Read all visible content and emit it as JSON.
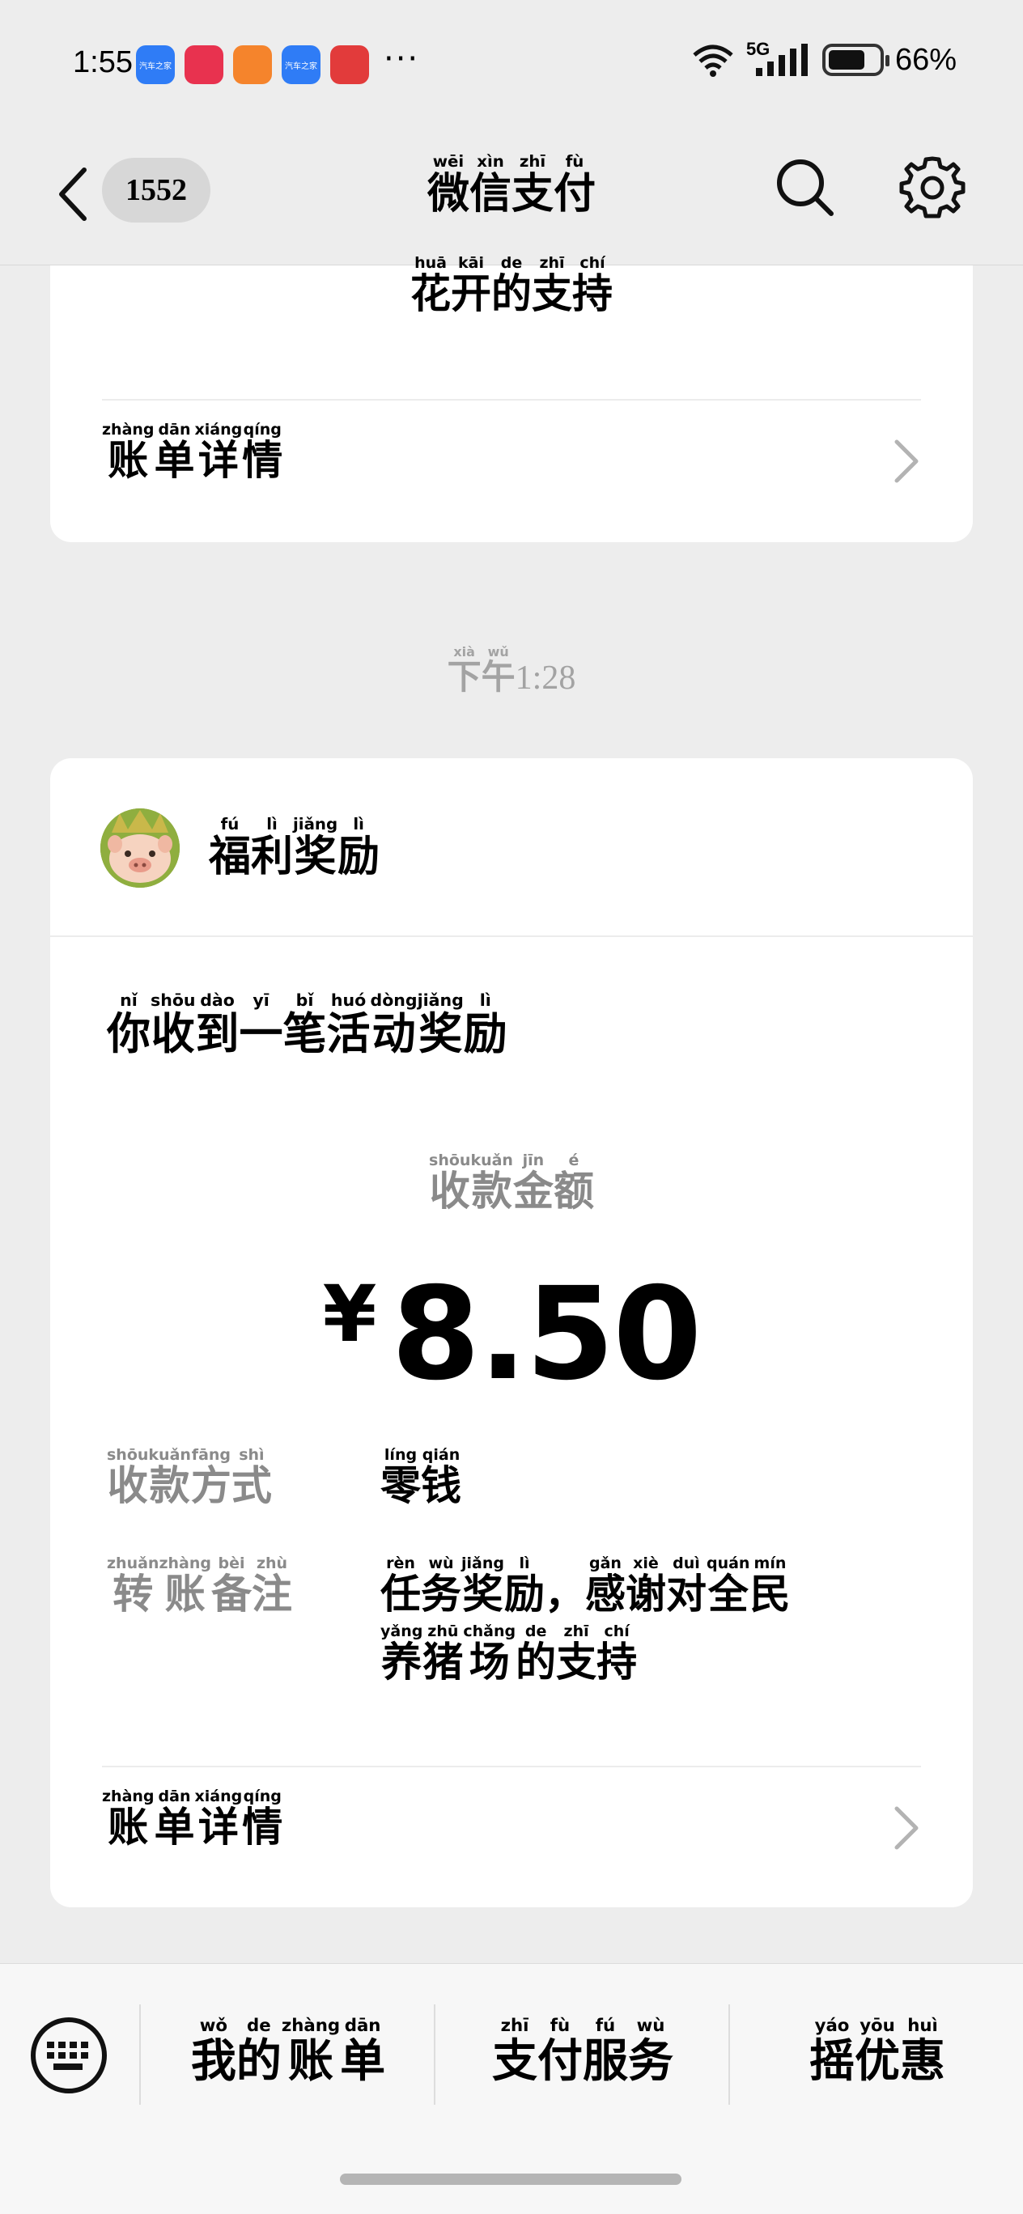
{
  "status_bar": {
    "time": "1:55",
    "app_icons": [
      {
        "name": "qiche-zhijia-icon",
        "label": "汽车之家",
        "color": "#2f7cf6"
      },
      {
        "name": "douyin-icon",
        "label": "",
        "color": "#e8324f"
      },
      {
        "name": "orange-app-icon",
        "label": "",
        "color": "#f5842c"
      },
      {
        "name": "qiche-zhijia-icon",
        "label": "汽车之家",
        "color": "#2f7cf6"
      },
      {
        "name": "red-app-icon",
        "label": "",
        "color": "#e23b3b"
      }
    ],
    "more": "···",
    "network": "5G",
    "battery": "66%"
  },
  "nav": {
    "unread_count": "1552",
    "title": [
      [
        "微",
        "wēi"
      ],
      [
        "信",
        "xìn"
      ],
      [
        "支",
        "zhī"
      ],
      [
        "付",
        "fù"
      ]
    ]
  },
  "prev_card": {
    "partial_text": [
      [
        "花",
        "huā"
      ],
      [
        "开",
        "kāi"
      ],
      [
        "的",
        "de"
      ],
      [
        "支",
        "zhī"
      ],
      [
        "持",
        "chí"
      ]
    ],
    "bill_details": [
      [
        "账",
        "zhàng"
      ],
      [
        "单",
        "dān"
      ],
      [
        "详",
        "xiáng"
      ],
      [
        "情",
        "qíng"
      ]
    ]
  },
  "time_separator": {
    "ruby": [
      [
        "下",
        "xià"
      ],
      [
        "午",
        "wǔ"
      ]
    ],
    "time": "1:28"
  },
  "main_card": {
    "sender": [
      [
        "福",
        "fú"
      ],
      [
        "利",
        "lì"
      ],
      [
        "奖",
        "jiǎng"
      ],
      [
        "励",
        "lì"
      ]
    ],
    "notice": [
      [
        "你",
        "nǐ"
      ],
      [
        "收",
        "shōu"
      ],
      [
        "到",
        "dào"
      ],
      [
        "一",
        "yī"
      ],
      [
        "笔",
        "bǐ"
      ],
      [
        "活",
        "huó"
      ],
      [
        "动",
        "dòng"
      ],
      [
        "奖",
        "jiǎng"
      ],
      [
        "励",
        "lì"
      ]
    ],
    "amount_label": [
      [
        "收",
        "shōu"
      ],
      [
        "款",
        "kuǎn"
      ],
      [
        "金",
        "jīn"
      ],
      [
        "额",
        "é"
      ]
    ],
    "currency": "¥",
    "amount": "8.50",
    "method_label": [
      [
        "收",
        "shōu"
      ],
      [
        "款",
        "kuǎn"
      ],
      [
        "方",
        "fāng"
      ],
      [
        "式",
        "shì"
      ]
    ],
    "method_value": [
      [
        "零",
        "líng"
      ],
      [
        "钱",
        "qián"
      ]
    ],
    "note_label": [
      [
        "转",
        "zhuǎn"
      ],
      [
        "账",
        "zhàng"
      ],
      [
        "备",
        "bèi"
      ],
      [
        "注",
        "zhù"
      ]
    ],
    "note_line1": [
      [
        "任",
        "rèn"
      ],
      [
        "务",
        "wù"
      ],
      [
        "奖",
        "jiǎng"
      ],
      [
        "励",
        "lì"
      ],
      [
        "，",
        ""
      ],
      [
        "感",
        "gǎn"
      ],
      [
        "谢",
        "xiè"
      ],
      [
        "对",
        "duì"
      ],
      [
        "全",
        "quán"
      ],
      [
        "民",
        "mín"
      ]
    ],
    "note_line2": [
      [
        "养",
        "yǎng"
      ],
      [
        "猪",
        "zhū"
      ],
      [
        "场",
        "chǎng"
      ],
      [
        "的",
        "de"
      ],
      [
        "支",
        "zhī"
      ],
      [
        "持",
        "chí"
      ]
    ],
    "bill_details": [
      [
        "账",
        "zhàng"
      ],
      [
        "单",
        "dān"
      ],
      [
        "详",
        "xiáng"
      ],
      [
        "情",
        "qíng"
      ]
    ]
  },
  "bottom_menu": [
    {
      "name": "menu-my-bills",
      "ruby": [
        [
          "我",
          "wǒ"
        ],
        [
          "的",
          "de"
        ],
        [
          "账",
          "zhàng"
        ],
        [
          "单",
          "dān"
        ]
      ]
    },
    {
      "name": "menu-payment-services",
      "ruby": [
        [
          "支",
          "zhī"
        ],
        [
          "付",
          "fù"
        ],
        [
          "服",
          "fú"
        ],
        [
          "务",
          "wù"
        ]
      ]
    },
    {
      "name": "menu-shake-offers",
      "ruby": [
        [
          "摇",
          "yáo"
        ],
        [
          "优",
          "yōu"
        ],
        [
          "惠",
          "huì"
        ]
      ]
    }
  ]
}
